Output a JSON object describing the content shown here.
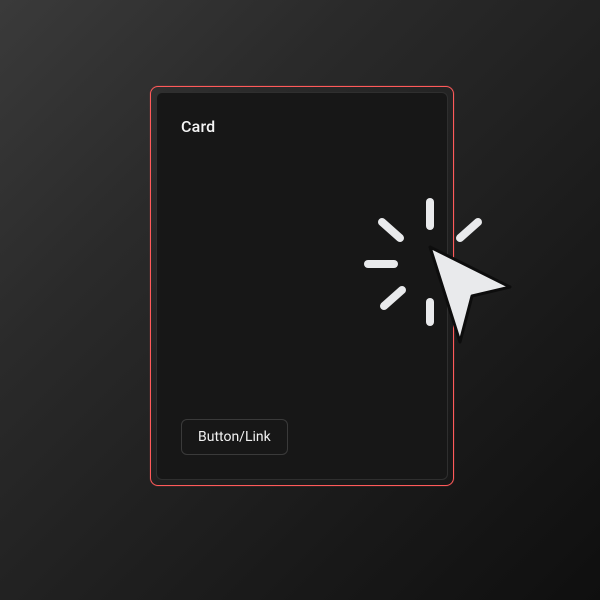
{
  "card": {
    "title": "Card",
    "button_label": "Button/Link"
  },
  "colors": {
    "accent": "#ff5a5a",
    "card_bg": "#171717",
    "text": "#f2f2f2"
  },
  "icons": {
    "cursor": "click-burst-cursor"
  }
}
